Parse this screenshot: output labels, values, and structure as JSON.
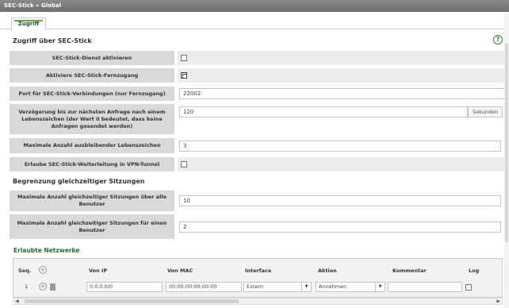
{
  "header": {
    "breadcrumb": "SEC-Stick » Global"
  },
  "tabs": [
    {
      "label": "Zugriff",
      "active": true
    }
  ],
  "section1": {
    "title": "Zugriff über SEC-Stick",
    "rows": [
      {
        "label": "SEC-Stick-Dienst aktivieren",
        "type": "checkbox",
        "checked": false
      },
      {
        "label": "Aktiviere SEC-Stick-Fernzugang",
        "type": "checkbox",
        "checked": true
      },
      {
        "label": "Port für SEC-Stick-Verbindungen (nur Fernzugang)",
        "type": "text",
        "value": "22002"
      },
      {
        "label": "Verzögerung bis zur nächsten Anfrage nach einem Lebenszeichen (der Wert 0 bedeutet, dass keine Anfragen gesendet werden)",
        "type": "text",
        "value": "120",
        "suffix": "Sekunden"
      },
      {
        "label": "Maximale Anzahl ausbleibender Lebenszeichen",
        "type": "text",
        "value": "3"
      },
      {
        "label": "Erlaube SEC-Stick-Weiterleitung in VPN-Tunnel",
        "type": "checkbox",
        "checked": false
      }
    ]
  },
  "section2": {
    "title": "Begrenzung gleichzeitiger Sitzungen",
    "rows": [
      {
        "label": "Maximale Anzahl gleichzeitiger Sitzungen über alle Benutzer",
        "type": "text",
        "value": "10"
      },
      {
        "label": "Maximale Anzahl gleichzeitiger Sitzungen für einen Benutzer",
        "type": "text",
        "value": "2"
      }
    ]
  },
  "networks": {
    "title": "Erlaubte Netzwerke",
    "columns": [
      "Seq.",
      "Von IP",
      "Von MAC",
      "Interface",
      "Aktion",
      "Kommentar",
      "Log"
    ],
    "rows": [
      {
        "seq": "1",
        "from_ip": "0.0.0.0/0",
        "from_mac": "00:00:00:00:00:00",
        "interface": "Extern",
        "action": "Annehmen",
        "comment": "",
        "log": false
      }
    ]
  },
  "colors": {
    "accent": "#2e7d32",
    "label_bg": "#d9d9d9",
    "titlebar": "#7a7a7a"
  }
}
